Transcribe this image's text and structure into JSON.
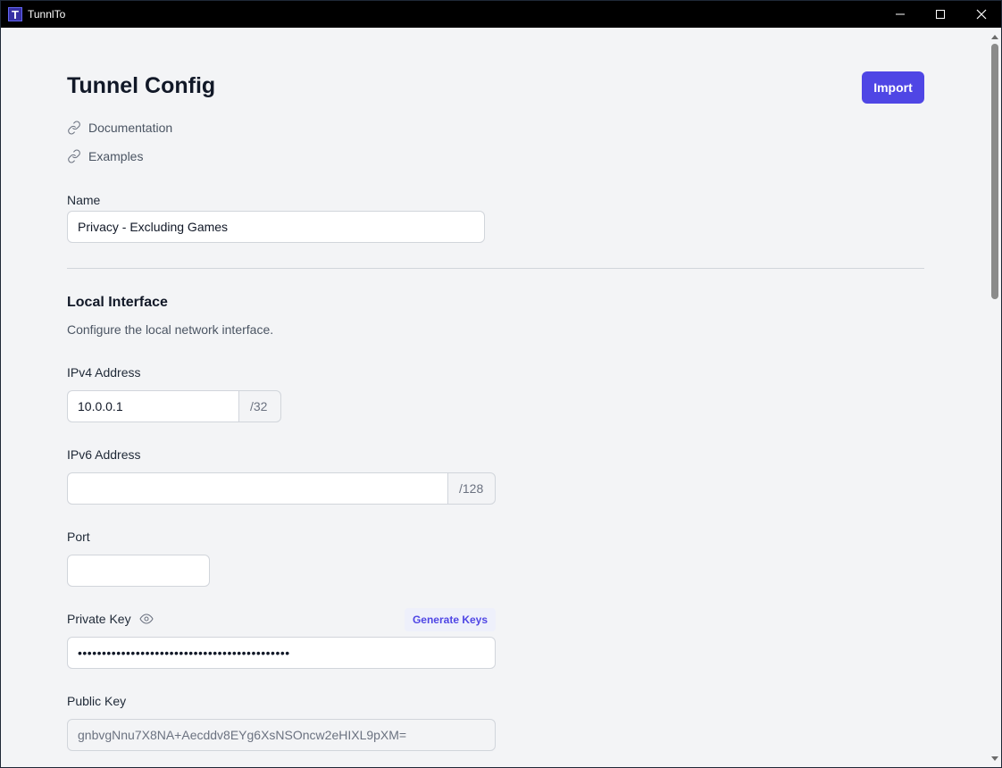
{
  "window": {
    "logo_letter": "T",
    "title": "TunnlTo"
  },
  "page": {
    "title": "Tunnel Config",
    "import_label": "Import",
    "links": [
      {
        "label": "Documentation"
      },
      {
        "label": "Examples"
      }
    ]
  },
  "name_field": {
    "label": "Name",
    "value": "Privacy - Excluding Games"
  },
  "local_interface": {
    "title": "Local Interface",
    "description": "Configure the local network interface.",
    "ipv4": {
      "label": "IPv4 Address",
      "value": "10.0.0.1",
      "suffix": "/32"
    },
    "ipv6": {
      "label": "IPv6 Address",
      "value": "",
      "suffix": "/128"
    },
    "port": {
      "label": "Port",
      "value": ""
    },
    "private_key": {
      "label": "Private Key",
      "generate_label": "Generate Keys",
      "masked_value": "••••••••••••••••••••••••••••••••••••••••••••"
    },
    "public_key": {
      "label": "Public Key",
      "value": "gnbvgNnu7X8NA+Aecddv8EYg6XsNSOncw2eHIXL9pXM="
    }
  },
  "colors": {
    "accent": "#4f46e5",
    "background": "#f3f4f6",
    "titlebar": "#000000"
  }
}
